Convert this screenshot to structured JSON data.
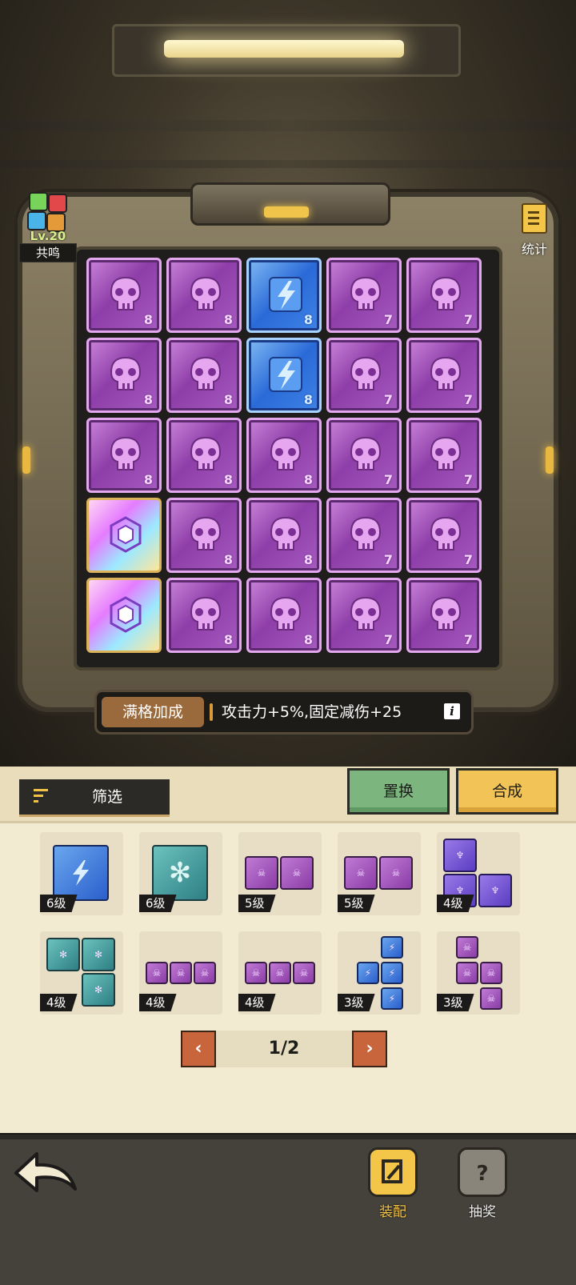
{
  "resonance": {
    "level": "Lv.20",
    "label": "共鸣"
  },
  "stats": {
    "label": "统计"
  },
  "board": {
    "rows": [
      [
        {
          "type": "purple",
          "icon": "skull-icon",
          "level": "8"
        },
        {
          "type": "purple",
          "icon": "skull-icon",
          "level": "8"
        },
        {
          "type": "blue",
          "icon": "lightning-icon",
          "level": "8"
        },
        {
          "type": "purple",
          "icon": "skull-icon",
          "level": "7"
        },
        {
          "type": "purple",
          "icon": "skull-icon",
          "level": "7"
        }
      ],
      [
        {
          "type": "purple",
          "icon": "skull-icon",
          "level": "8"
        },
        {
          "type": "purple",
          "icon": "skull-icon",
          "level": "8"
        },
        {
          "type": "blue",
          "icon": "lightning-icon",
          "level": "8"
        },
        {
          "type": "purple",
          "icon": "skull-icon",
          "level": "7"
        },
        {
          "type": "purple",
          "icon": "skull-icon",
          "level": "7"
        }
      ],
      [
        {
          "type": "purple",
          "icon": "skull-icon",
          "level": "8"
        },
        {
          "type": "purple",
          "icon": "skull-icon",
          "level": "8"
        },
        {
          "type": "purple",
          "icon": "skull-icon",
          "level": "8"
        },
        {
          "type": "purple",
          "icon": "skull-icon",
          "level": "7"
        },
        {
          "type": "purple",
          "icon": "skull-icon",
          "level": "7"
        }
      ],
      [
        {
          "type": "rainbow",
          "icon": "hexagon-crystal-icon",
          "level": ""
        },
        {
          "type": "purple",
          "icon": "skull-icon",
          "level": "8"
        },
        {
          "type": "purple",
          "icon": "skull-icon",
          "level": "8"
        },
        {
          "type": "purple",
          "icon": "skull-icon",
          "level": "7"
        },
        {
          "type": "purple",
          "icon": "skull-icon",
          "level": "7"
        }
      ],
      [
        {
          "type": "rainbow",
          "icon": "hexagon-crystal-icon",
          "level": ""
        },
        {
          "type": "purple",
          "icon": "skull-icon",
          "level": "8"
        },
        {
          "type": "purple",
          "icon": "skull-icon",
          "level": "8"
        },
        {
          "type": "purple",
          "icon": "skull-icon",
          "level": "7"
        },
        {
          "type": "purple",
          "icon": "skull-icon",
          "level": "7"
        }
      ]
    ]
  },
  "bonus": {
    "label": "满格加成",
    "text": "攻击力+5%,固定减伤+25",
    "info": "i"
  },
  "toolbar": {
    "filter_label": "筛选",
    "swap_label": "置换",
    "merge_label": "合成"
  },
  "inventory": [
    {
      "level": "6级",
      "shape": "blue-single"
    },
    {
      "level": "6级",
      "shape": "teal-single"
    },
    {
      "level": "5级",
      "shape": "purple-2h"
    },
    {
      "level": "5级",
      "shape": "purple-2h"
    },
    {
      "level": "4级",
      "shape": "violet-L"
    },
    {
      "level": "4级",
      "shape": "teal-L"
    },
    {
      "level": "4级",
      "shape": "purple-3h"
    },
    {
      "level": "4级",
      "shape": "purple-3h"
    },
    {
      "level": "3级",
      "shape": "blue-T"
    },
    {
      "level": "3级",
      "shape": "purple-T"
    }
  ],
  "pager": {
    "prev": "‹",
    "label": "1/2",
    "next": "›"
  },
  "nav": {
    "equip_label": "装配",
    "lottery_label": "抽奖"
  },
  "colors": {
    "accent": "#f3c64a",
    "purple": "#a65bc0",
    "blue": "#3f83e6",
    "swap_green": "#7db57f"
  }
}
